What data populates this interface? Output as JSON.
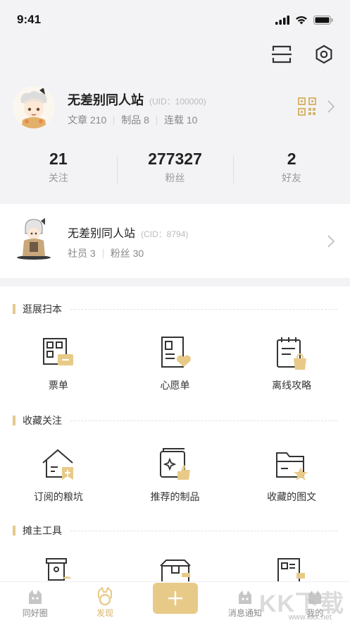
{
  "status": {
    "time": "9:41"
  },
  "profile": {
    "name": "无差别同人站",
    "uid": "(UID：100000)",
    "articles": "文章 210",
    "products": "制品 8",
    "serials": "连载 10"
  },
  "counts": [
    {
      "num": "21",
      "label": "关注"
    },
    {
      "num": "277327",
      "label": "粉丝"
    },
    {
      "num": "2",
      "label": "好友"
    }
  ],
  "club": {
    "name": "无差别同人站",
    "cid": "(CID：8794)",
    "members": "社员 3",
    "fans": "粉丝 30"
  },
  "sections": [
    {
      "title": "逛展扫本",
      "items": [
        {
          "label": "票单",
          "icon": "ticket-icon"
        },
        {
          "label": "心愿单",
          "icon": "wishlist-icon"
        },
        {
          "label": "离线攻略",
          "icon": "offline-guide-icon"
        }
      ]
    },
    {
      "title": "收藏关注",
      "items": [
        {
          "label": "订阅的粮坑",
          "icon": "subscribed-icon"
        },
        {
          "label": "推荐的制品",
          "icon": "recommended-icon"
        },
        {
          "label": "收藏的图文",
          "icon": "collected-icon"
        }
      ]
    },
    {
      "title": "摊主工具",
      "items": []
    }
  ],
  "tabs": [
    {
      "label": "同好圈"
    },
    {
      "label": "发现"
    },
    {
      "label": ""
    },
    {
      "label": "消息通知"
    },
    {
      "label": "我的"
    }
  ],
  "colors": {
    "accent": "#e8ca88",
    "accent_text": "#d8b56c"
  },
  "watermark": {
    "text": "KK下载",
    "sub": "www.kkx.net"
  }
}
